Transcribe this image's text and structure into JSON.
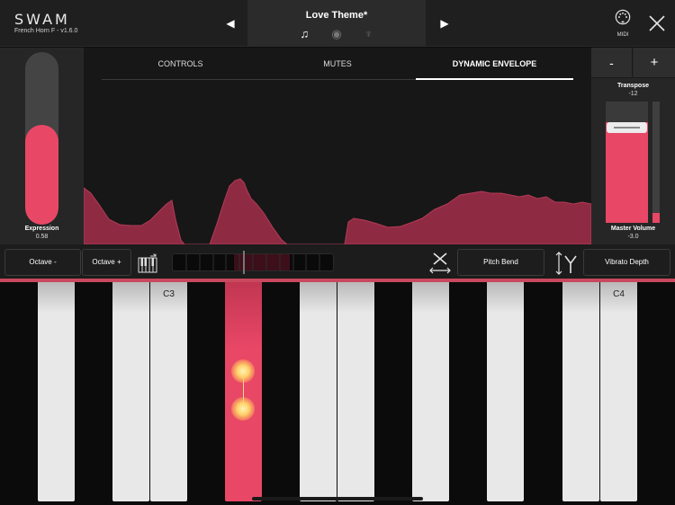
{
  "header": {
    "brand": "SWAM",
    "version": "French Horn F - v1.6.0",
    "preset_name": "Love Theme*",
    "prev_glyph": "◀",
    "next_glyph": "▶",
    "preset_icons": [
      "music-note-icon",
      "round-badge-icon",
      "tuning-fork-icon"
    ],
    "preset_icon_glyphs": [
      "♫",
      "◉",
      "♆"
    ],
    "midi_label": "MIDI"
  },
  "expression": {
    "label": "Expression",
    "value": "0.58",
    "level": 0.58
  },
  "tabs": [
    {
      "label": "CONTROLS",
      "active": false
    },
    {
      "label": "MUTES",
      "active": false
    },
    {
      "label": "DYNAMIC ENVELOPE",
      "active": true
    }
  ],
  "right_panel": {
    "minus_label": "-",
    "plus_label": "+",
    "transpose_label": "Transpose",
    "transpose_value": "-12",
    "volume_label": "Master Volume",
    "volume_value": "-3.0",
    "volume_level": 0.83,
    "meter_level": 0.08
  },
  "strip": {
    "octave_minus_label": "Octave -",
    "octave_plus_label": "Octave +",
    "pitch_bend_label": "Pitch Bend",
    "vibrato_depth_label": "Vibrato Depth",
    "range_segments": 12,
    "range_highlight": [
      0.38,
      0.73
    ],
    "range_marker": 0.44
  },
  "keyboard": {
    "white_keys": [
      {
        "label": ""
      },
      {
        "label": ""
      },
      {
        "label": "C3"
      },
      {
        "label": "",
        "pressed": true
      },
      {
        "label": ""
      },
      {
        "label": ""
      },
      {
        "label": ""
      },
      {
        "label": ""
      },
      {
        "label": "C4"
      }
    ]
  },
  "colors": {
    "accent": "#e94766",
    "envelope_fill": "#8f2a43",
    "envelope_stroke": "#b23b57"
  }
}
